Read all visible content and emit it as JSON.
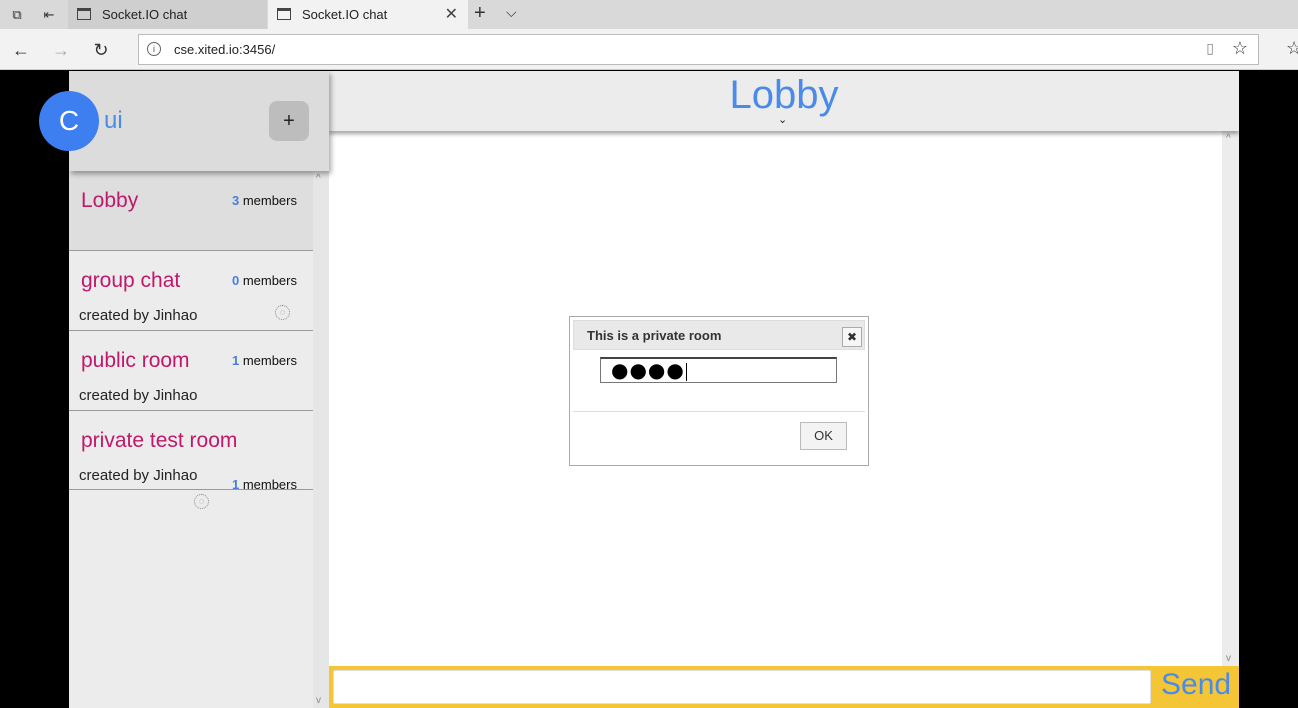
{
  "browser": {
    "tabs": [
      {
        "label": "Socket.IO chat"
      },
      {
        "label": "Socket.IO chat"
      }
    ],
    "url": "cse.xited.io:3456/"
  },
  "user": {
    "avatar_letter": "C",
    "name": "ui",
    "add_label": "+"
  },
  "rooms": [
    {
      "name": "Lobby",
      "count": "3",
      "members_label": "members",
      "creator": ""
    },
    {
      "name": "group chat",
      "count": "0",
      "members_label": "members",
      "creator": "created by Jinhao"
    },
    {
      "name": "public room",
      "count": "1",
      "members_label": "members",
      "creator": "created by Jinhao"
    },
    {
      "name": "private test room",
      "count": "1",
      "members_label": "members",
      "creator": "created by Jinhao"
    }
  ],
  "main": {
    "room_title": "Lobby",
    "send_label": "Send"
  },
  "dialog": {
    "title": "This is a private room",
    "password_mask": "●●●●",
    "ok_label": "OK"
  },
  "colors": {
    "accent_blue": "#4a8bea",
    "room_name": "#c0186a",
    "composer_bg": "#f4c534"
  }
}
